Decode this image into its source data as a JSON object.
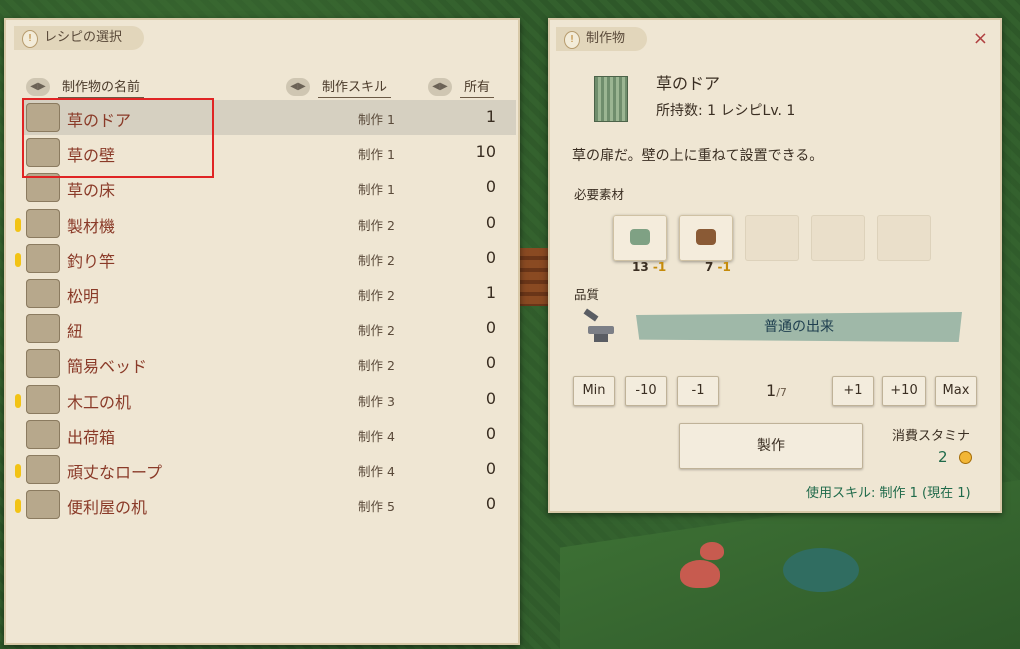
{
  "recipe_list": {
    "title": "レシピの選択",
    "columns": {
      "name": "制作物の名前",
      "skill": "制作スキル",
      "owned": "所有"
    },
    "rows": [
      {
        "name": "草のドア",
        "skill": "制作 1",
        "owned": "1",
        "selected": true,
        "alert": false,
        "icon": "grass-door-icon"
      },
      {
        "name": "草の壁",
        "skill": "制作 1",
        "owned": "10",
        "selected": false,
        "alert": false,
        "icon": "grass-wall-icon"
      },
      {
        "name": "草の床",
        "skill": "制作 1",
        "owned": "0",
        "selected": false,
        "alert": false,
        "icon": "grass-floor-icon"
      },
      {
        "name": "製材機",
        "skill": "制作 2",
        "owned": "0",
        "selected": false,
        "alert": true,
        "icon": "sawmill-icon"
      },
      {
        "name": "釣り竿",
        "skill": "制作 2",
        "owned": "0",
        "selected": false,
        "alert": true,
        "icon": "fishing-rod-icon"
      },
      {
        "name": "松明",
        "skill": "制作 2",
        "owned": "1",
        "selected": false,
        "alert": false,
        "icon": "torch-icon"
      },
      {
        "name": "紐",
        "skill": "制作 2",
        "owned": "0",
        "selected": false,
        "alert": false,
        "icon": "string-icon"
      },
      {
        "name": "簡易ベッド",
        "skill": "制作 2",
        "owned": "0",
        "selected": false,
        "alert": false,
        "icon": "simple-bed-icon"
      },
      {
        "name": "木工の机",
        "skill": "制作 3",
        "owned": "0",
        "selected": false,
        "alert": true,
        "icon": "woodwork-desk-icon"
      },
      {
        "name": "出荷箱",
        "skill": "制作 4",
        "owned": "0",
        "selected": false,
        "alert": false,
        "icon": "shipping-box-icon"
      },
      {
        "name": "頑丈なロープ",
        "skill": "制作 4",
        "owned": "0",
        "selected": false,
        "alert": true,
        "icon": "sturdy-rope-icon"
      },
      {
        "name": "便利屋の机",
        "skill": "制作 5",
        "owned": "0",
        "selected": false,
        "alert": true,
        "icon": "handyman-desk-icon"
      }
    ]
  },
  "detail": {
    "title": "制作物",
    "close_label": "×",
    "item_name": "草のドア",
    "item_sub": "所持数: 1  レシピLv. 1",
    "description": "草の扉だ。壁の上に重ねて設置できる。",
    "materials_label": "必要素材",
    "materials": [
      {
        "icon": "grass-bundle-icon",
        "have": "13",
        "need": "-1"
      },
      {
        "icon": "log-pile-icon",
        "have": "7",
        "need": "-1"
      }
    ],
    "quality_label": "品質",
    "quality_value": "普通の出来",
    "quantity_buttons": {
      "min": "Min",
      "minus10": "-10",
      "minus1": "-1",
      "plus1": "+1",
      "plus10": "+10",
      "max": "Max"
    },
    "quantity": {
      "current": "1",
      "max": "/7"
    },
    "make_button": "製作",
    "stamina_label": "消費スタミナ",
    "stamina_value": "2",
    "skill_line": "使用スキル: 制作 1 (現在 1)"
  },
  "colors": {
    "accent_alert": "#f2c315",
    "highlight_box": "#e02424",
    "text_red": "#8a3a28",
    "text_green": "#1f6a4a"
  }
}
